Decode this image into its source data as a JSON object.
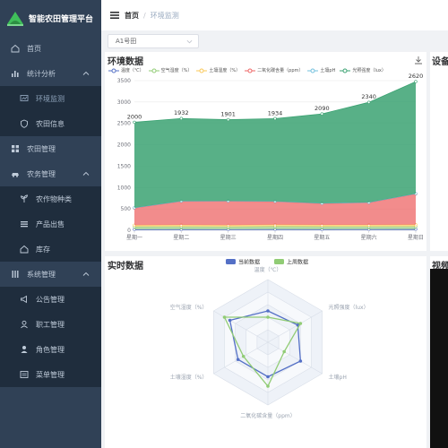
{
  "app": {
    "title": "智能农田管理平台"
  },
  "colors": {
    "sidebar": "#304156",
    "active": "#8fa4bb"
  },
  "sidebar": {
    "items": [
      {
        "label": "首页",
        "icon": "home-icon"
      },
      {
        "label": "统计分析",
        "icon": "bar-chart-icon",
        "expanded": true
      },
      {
        "label": "环境监测",
        "icon": "monitor-icon",
        "active": true
      },
      {
        "label": "农田信息",
        "icon": "shield-icon"
      },
      {
        "label": "农田管理",
        "icon": "grid-icon"
      },
      {
        "label": "农务管理",
        "icon": "car-icon",
        "expanded": true
      },
      {
        "label": "农作物种类",
        "icon": "sprout-icon"
      },
      {
        "label": "产品出售",
        "icon": "list-icon"
      },
      {
        "label": "库存",
        "icon": "home-icon"
      },
      {
        "label": "系统管理",
        "icon": "bars-icon",
        "expanded": true
      },
      {
        "label": "公告管理",
        "icon": "announcement-icon"
      },
      {
        "label": "职工管理",
        "icon": "user-icon"
      },
      {
        "label": "角色管理",
        "icon": "role-icon"
      },
      {
        "label": "菜单管理",
        "icon": "menu-icon"
      }
    ]
  },
  "header": {
    "breadcrumb": {
      "home": "首页",
      "separator": "/",
      "current": "环境监测"
    }
  },
  "field_select": {
    "value": "A1号田"
  },
  "panels": {
    "env_title": "环境数据",
    "device_title": "设备",
    "realtime_title": "实时数据",
    "video_title": "视频"
  },
  "chart_data": [
    {
      "type": "area",
      "title": "环境数据",
      "categories": [
        "星期一",
        "星期二",
        "星期三",
        "星期四",
        "星期五",
        "星期六",
        "星期日"
      ],
      "ylim": [
        0,
        3500
      ],
      "yticks": [
        0,
        500,
        1000,
        1500,
        2000,
        2500,
        3000,
        3500
      ],
      "grid": true,
      "legend_position": "top",
      "series": [
        {
          "name": "温度（℃）",
          "color": "#5470c6",
          "values": [
            20,
            22,
            21,
            23,
            22,
            24,
            25
          ]
        },
        {
          "name": "空气湿度（%）",
          "color": "#91cc75",
          "values": [
            60,
            62,
            58,
            65,
            63,
            60,
            61
          ]
        },
        {
          "name": "土壤湿度（%）",
          "color": "#fac858",
          "values": [
            40,
            42,
            41,
            43,
            40,
            42,
            44
          ]
        },
        {
          "name": "二氧化碳含量（ppm）",
          "color": "#ee6666",
          "values": [
            400,
            550,
            560,
            540,
            500,
            520,
            720
          ]
        },
        {
          "name": "土壤pH",
          "color": "#73c0de",
          "values": [
            7,
            7,
            7,
            7,
            7,
            7,
            7
          ]
        },
        {
          "name": "光照强度（lux）",
          "color": "#3ba272",
          "values": [
            2000,
            1932,
            1901,
            1934,
            2090,
            2340,
            2620
          ]
        }
      ],
      "data_labels": [
        2000,
        1932,
        1901,
        1934,
        2090,
        2340,
        2620
      ]
    },
    {
      "type": "radar",
      "title": "实时数据",
      "legend_position": "top",
      "indicators": [
        "温度（℃）",
        "光照强度（lux）",
        "土壤pH",
        "二氧化碳含量（ppm）",
        "土壤湿度（%）",
        "空气湿度（%）"
      ],
      "series": [
        {
          "name": "当前数据",
          "color": "#5470c6",
          "values": [
            0.5,
            0.55,
            0.6,
            0.55,
            0.55,
            0.7
          ]
        },
        {
          "name": "上周数据",
          "color": "#91cc75",
          "values": [
            0.4,
            0.6,
            0.3,
            0.7,
            0.45,
            0.8
          ]
        }
      ]
    }
  ]
}
